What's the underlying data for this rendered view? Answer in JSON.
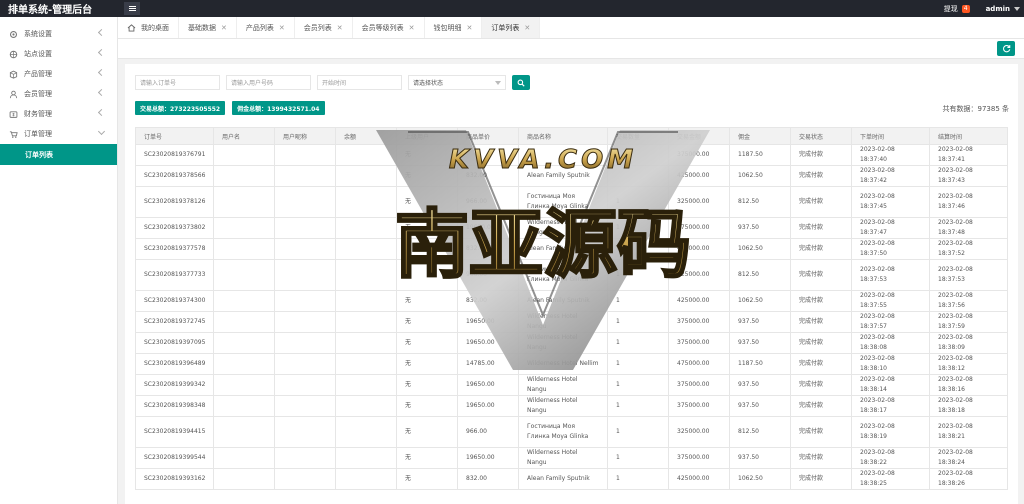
{
  "app": {
    "title": "排单系统-管理后台"
  },
  "header": {
    "notice_label": "提现",
    "notice_count": "4",
    "user": "admin"
  },
  "sidebar": {
    "items": [
      {
        "label": "系统设置",
        "icon": "gear-icon"
      },
      {
        "label": "站点设置",
        "icon": "settings-icon"
      },
      {
        "label": "产品管理",
        "icon": "box-icon"
      },
      {
        "label": "会员管理",
        "icon": "user-icon"
      },
      {
        "label": "财务管理",
        "icon": "money-icon"
      },
      {
        "label": "订单管理",
        "icon": "order-icon"
      }
    ],
    "active_sub": "订单列表"
  },
  "tabs": [
    {
      "label": "我的桌面"
    },
    {
      "label": "基础数据"
    },
    {
      "label": "产品列表"
    },
    {
      "label": "会员列表"
    },
    {
      "label": "会员等级列表"
    },
    {
      "label": "钱包明细"
    },
    {
      "label": "订单列表"
    }
  ],
  "filters": {
    "order_no": "请输入订单号",
    "user_no": "请输入用户号码",
    "start_time": "开始时间",
    "status": "请选择状态"
  },
  "summary": {
    "trade_total": "交易总额：273223505552",
    "commission_total": "佣金总额：1399432571.04",
    "count": "共有数据：97385 条"
  },
  "table": {
    "headers": [
      "订单号",
      "用户名",
      "用户昵称",
      "余额",
      "上级用户",
      "商品单价",
      "商品名称",
      "交易数量",
      "交易金额",
      "佣金",
      "交易状态",
      "下单时间",
      "结算时间"
    ],
    "rows": [
      [
        "SC23020819376791",
        "",
        "",
        "",
        "无",
        "",
        "",
        "",
        "375000.00",
        "1187.50",
        "完成付款",
        "2023-02-08 18:37:40",
        "2023-02-08 18:37:41"
      ],
      [
        "SC23020819378566",
        "",
        "",
        "",
        "无",
        "832.00",
        "Alean Family Sputnik",
        "",
        "425000.00",
        "1062.50",
        "完成付款",
        "2023-02-08 18:37:42",
        "2023-02-08 18:37:43"
      ],
      [
        "SC23020819378126",
        "",
        "",
        "",
        "无",
        "966.00",
        "Гостиница Моя Глинка Moya Glinka",
        "1",
        "325000.00",
        "812.50",
        "完成付款",
        "2023-02-08 18:37:45",
        "2023-02-08 18:37:46"
      ],
      [
        "SC23020819373802",
        "",
        "",
        "",
        "无",
        "19650.00",
        "Wilderness Hotel Nangu",
        "1",
        "375000.00",
        "937.50",
        "完成付款",
        "2023-02-08 18:37:47",
        "2023-02-08 18:37:48"
      ],
      [
        "SC23020819377578",
        "",
        "",
        "",
        "无",
        "832.00",
        "Alean Family Sputnik",
        "1",
        "425000.00",
        "1062.50",
        "完成付款",
        "2023-02-08 18:37:50",
        "2023-02-08 18:37:52"
      ],
      [
        "SC23020819377733",
        "",
        "",
        "",
        "无",
        "966.00",
        "Гостиница Моя Глинка Moya Glinka",
        "1",
        "325000.00",
        "812.50",
        "完成付款",
        "2023-02-08 18:37:53",
        "2023-02-08 18:37:53"
      ],
      [
        "SC23020819374300",
        "",
        "",
        "",
        "无",
        "832.00",
        "Alean Family Sputnik",
        "1",
        "425000.00",
        "1062.50",
        "完成付款",
        "2023-02-08 18:37:55",
        "2023-02-08 18:37:56"
      ],
      [
        "SC23020819372745",
        "",
        "",
        "",
        "无",
        "19650.00",
        "Wilderness Hotel Nangu",
        "1",
        "375000.00",
        "937.50",
        "完成付款",
        "2023-02-08 18:37:57",
        "2023-02-08 18:37:59"
      ],
      [
        "SC23020819397095",
        "",
        "",
        "",
        "无",
        "19650.00",
        "Wilderness Hotel Nangu",
        "1",
        "375000.00",
        "937.50",
        "完成付款",
        "2023-02-08 18:38:08",
        "2023-02-08 18:38:09"
      ],
      [
        "SC23020819396489",
        "",
        "",
        "",
        "无",
        "14785.00",
        "Wilderness Hotel Nellim",
        "1",
        "475000.00",
        "1187.50",
        "完成付款",
        "2023-02-08 18:38:10",
        "2023-02-08 18:38:12"
      ],
      [
        "SC23020819399342",
        "",
        "",
        "",
        "无",
        "19650.00",
        "Wilderness Hotel Nangu",
        "1",
        "375000.00",
        "937.50",
        "完成付款",
        "2023-02-08 18:38:14",
        "2023-02-08 18:38:16"
      ],
      [
        "SC23020819398348",
        "",
        "",
        "",
        "无",
        "19650.00",
        "Wilderness Hotel Nangu",
        "1",
        "375000.00",
        "937.50",
        "完成付款",
        "2023-02-08 18:38:17",
        "2023-02-08 18:38:18"
      ],
      [
        "SC23020819394415",
        "",
        "",
        "",
        "无",
        "966.00",
        "Гостиница Моя Глинка Moya Glinka",
        "1",
        "325000.00",
        "812.50",
        "完成付款",
        "2023-02-08 18:38:19",
        "2023-02-08 18:38:21"
      ],
      [
        "SC23020819399544",
        "",
        "",
        "",
        "无",
        "19650.00",
        "Wilderness Hotel Nangu",
        "1",
        "375000.00",
        "937.50",
        "完成付款",
        "2023-02-08 18:38:22",
        "2023-02-08 18:38:24"
      ],
      [
        "SC23020819393162",
        "",
        "",
        "",
        "无",
        "832.00",
        "Alean Family Sputnik",
        "1",
        "425000.00",
        "1062.50",
        "完成付款",
        "2023-02-08 18:38:25",
        "2023-02-08 18:38:26"
      ]
    ]
  },
  "watermark": {
    "top_text": "KVVA.COM",
    "main_text": "南亚源码"
  },
  "colors": {
    "accent": "#009688",
    "header": "#23262e",
    "badge": "#ff5722"
  }
}
